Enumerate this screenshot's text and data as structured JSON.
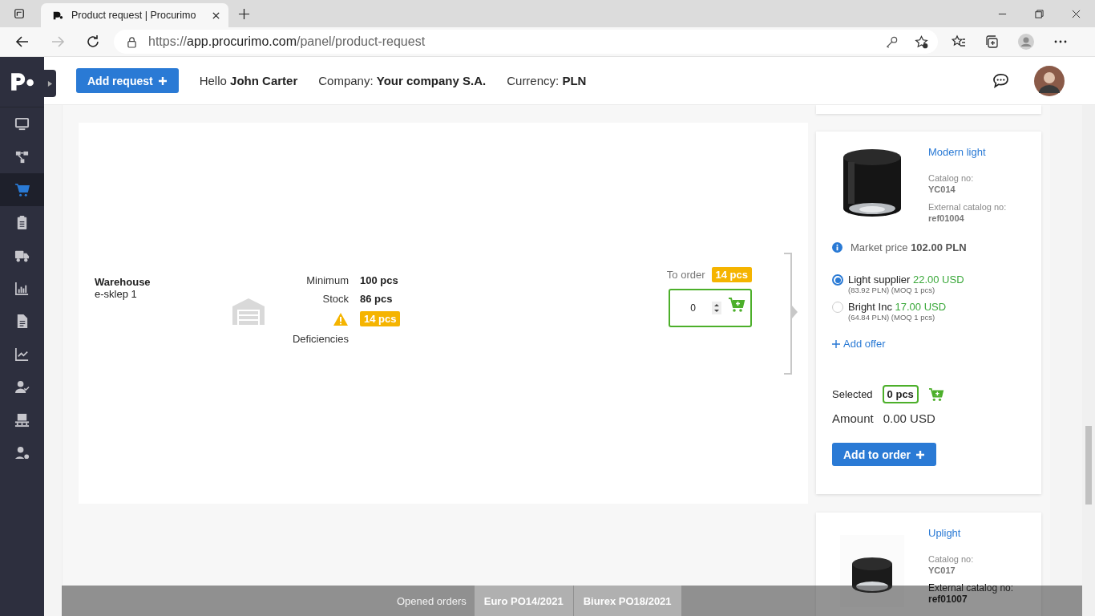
{
  "browser": {
    "tab_title": "Product request | Procurimo",
    "url_scheme": "https://",
    "url_host": "app.procurimo.com",
    "url_path": "/panel/product-request"
  },
  "header": {
    "add_request": "Add request",
    "greeting": "Hello",
    "user": "John Carter",
    "company_label": "Company:",
    "company": "Your company S.A.",
    "currency_label": "Currency:",
    "currency": "PLN"
  },
  "sidebar": {
    "items": [
      {
        "kind": "monitor",
        "selected": false
      },
      {
        "kind": "hierarchy",
        "selected": false
      },
      {
        "kind": "cart",
        "selected": true
      },
      {
        "kind": "clipboard",
        "selected": false
      },
      {
        "kind": "truck",
        "selected": false
      },
      {
        "kind": "barchart",
        "selected": false
      },
      {
        "kind": "document",
        "selected": false
      },
      {
        "kind": "linechart",
        "selected": false
      },
      {
        "kind": "usercheck",
        "selected": false
      },
      {
        "kind": "pallet",
        "selected": false
      },
      {
        "kind": "usergear",
        "selected": false
      }
    ]
  },
  "request": {
    "location_label": "Warehouse",
    "location": "e-sklep 1",
    "minimum_label": "Minimum",
    "minimum": "100 pcs",
    "stock_label": "Stock",
    "stock": "86 pcs",
    "deficiency": "14 pcs",
    "deficiencies_label": "Deficiencies",
    "to_order_label": "To order",
    "to_order": "14 pcs",
    "quantity": "0"
  },
  "product": {
    "name": "Modern light",
    "catalog_label": "Catalog no:",
    "catalog_no": "YC014",
    "external_label": "External catalog no:",
    "external_no": "ref01004",
    "market_price_label": "Market price",
    "market_price": "102.00 PLN",
    "offers": [
      {
        "supplier": "Light supplier",
        "price": "22.00 USD",
        "details": "(83.92 PLN) (MOQ 1 pcs)",
        "selected": true
      },
      {
        "supplier": "Bright Inc",
        "price": "17.00 USD",
        "details": "(64.84 PLN) (MOQ 1 pcs)",
        "selected": false
      }
    ],
    "add_offer": "Add offer",
    "selected_label": "Selected",
    "selected_qty": "0 pcs",
    "amount_label": "Amount",
    "amount": "0.00 USD",
    "add_to_order": "Add to order"
  },
  "next_product": {
    "name": "Uplight",
    "catalog_label": "Catalog no:",
    "catalog_no": "YC017",
    "external_label": "External catalog no:",
    "external_no": "ref01007"
  },
  "orders_bar": {
    "label": "Opened orders",
    "orders": [
      "Euro PO14/2021",
      "Biurex PO18/2021"
    ]
  }
}
